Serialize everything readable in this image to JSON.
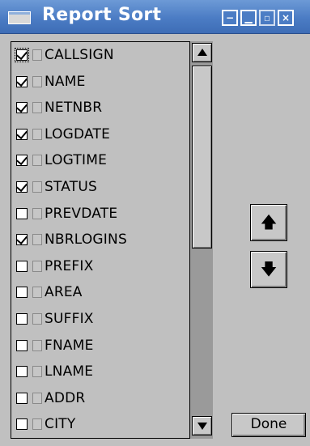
{
  "window": {
    "title": "Report Sort",
    "controls": [
      "−",
      "▁",
      "▫",
      "×"
    ]
  },
  "fields": [
    {
      "label": "CALLSIGN",
      "checked": true,
      "focused": true
    },
    {
      "label": "NAME",
      "checked": true
    },
    {
      "label": "NETNBR",
      "checked": true
    },
    {
      "label": "LOGDATE",
      "checked": true
    },
    {
      "label": "LOGTIME",
      "checked": true
    },
    {
      "label": "STATUS",
      "checked": true
    },
    {
      "label": "PREVDATE",
      "checked": false
    },
    {
      "label": "NBRLOGINS",
      "checked": true
    },
    {
      "label": "PREFIX",
      "checked": false
    },
    {
      "label": "AREA",
      "checked": false
    },
    {
      "label": "SUFFIX",
      "checked": false
    },
    {
      "label": "FNAME",
      "checked": false
    },
    {
      "label": "LNAME",
      "checked": false
    },
    {
      "label": "ADDR",
      "checked": false
    },
    {
      "label": "CITY",
      "checked": false
    }
  ],
  "buttons": {
    "move_up": "🡅",
    "move_down": "🡇",
    "done": "Done"
  },
  "icons": {
    "move_up": "up-arrow-icon",
    "move_down": "down-arrow-icon"
  }
}
